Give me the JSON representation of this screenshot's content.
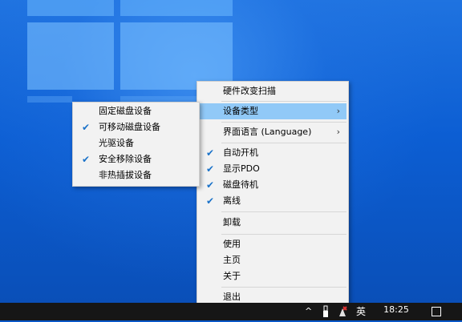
{
  "main_menu": {
    "items": [
      {
        "label": "硬件改变扫描",
        "checked": false,
        "has_submenu": false
      },
      {
        "label": "设备类型",
        "checked": false,
        "has_submenu": true,
        "highlighted": true
      },
      {
        "label": "界面语言 (Language)",
        "checked": false,
        "has_submenu": true
      },
      {
        "label": "自动开机",
        "checked": true
      },
      {
        "label": "显示PDO",
        "checked": true
      },
      {
        "label": "磁盘待机",
        "checked": true
      },
      {
        "label": "离线",
        "checked": true
      },
      {
        "label": "卸载",
        "checked": false
      },
      {
        "label": "使用",
        "checked": false
      },
      {
        "label": "主页",
        "checked": false
      },
      {
        "label": "关于",
        "checked": false
      },
      {
        "label": "退出",
        "checked": false
      }
    ],
    "check_glyph": "✔",
    "arrow_glyph": "›"
  },
  "sub_menu": {
    "items": [
      {
        "label": "固定磁盘设备",
        "checked": false
      },
      {
        "label": "可移动磁盘设备",
        "checked": true
      },
      {
        "label": "光驱设备",
        "checked": false
      },
      {
        "label": "安全移除设备",
        "checked": true
      },
      {
        "label": "非热插拔设备",
        "checked": false
      }
    ]
  },
  "taskbar": {
    "tray_chevron": "^",
    "usb_icon": "usb-icon",
    "ime": "英",
    "time": "18:25",
    "date": "",
    "highlight_color": "#91c9f7",
    "check_color": "#1a72c9"
  }
}
